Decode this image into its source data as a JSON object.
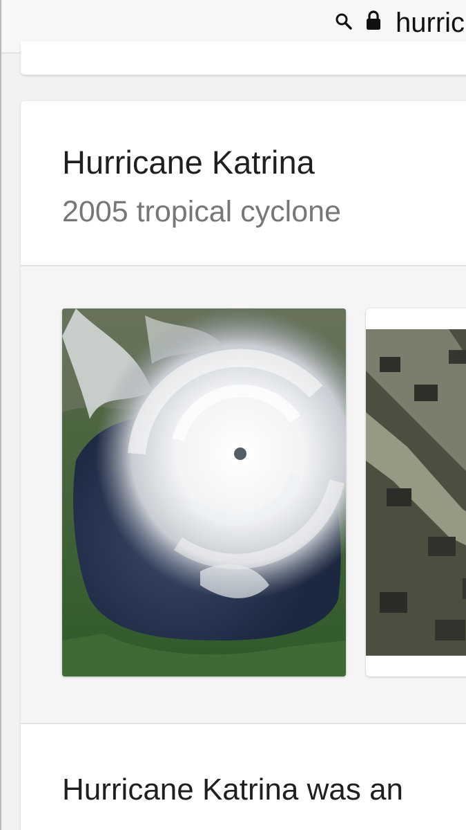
{
  "browser": {
    "url_text": "hurric",
    "icons": [
      "search-icon",
      "lock-icon"
    ]
  },
  "knowledge_panel": {
    "title": "Hurricane Katrina",
    "subtitle": "2005 tropical cyclone",
    "images": [
      {
        "name": "satellite-image",
        "depicts": "hurricane-satellite-view"
      },
      {
        "name": "flood-image",
        "depicts": "flooded-neighborhood"
      }
    ],
    "description": "Hurricane Katrina was an"
  },
  "colors": {
    "title": "#1f1f1f",
    "subtitle": "#777777",
    "card_background": "#ffffff",
    "page_background": "#f2f2f2"
  }
}
